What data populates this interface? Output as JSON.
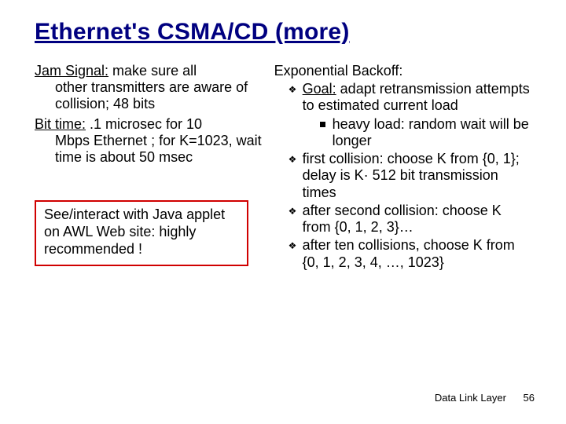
{
  "title": "Ethernet's CSMA/CD (more)",
  "left": {
    "jam": {
      "label": "Jam Signal:",
      "text": " make sure all other transmitters are aware of collision; 48 bits"
    },
    "bit": {
      "label": "Bit time:",
      "text": " .1 microsec for 10 Mbps Ethernet ; for K=1023, wait time is about 50 msec"
    },
    "callout": "See/interact with Java applet on AWL Web site: highly recommended !"
  },
  "right": {
    "head": "Exponential Backoff:",
    "b1_goal_label": "Goal:",
    "b1_goal_text": " adapt retransmission attempts to estimated current load",
    "b1_sub": "heavy load: random wait will be longer",
    "b2": "first collision: choose K from {0, 1}; delay is K· 512 bit transmission times",
    "b3": "after second collision: choose K from {0, 1, 2, 3}…",
    "b4": "after ten collisions, choose K from {0, 1, 2, 3, 4, …, 1023}"
  },
  "footer": {
    "section": "Data Link Layer",
    "page": "56"
  }
}
